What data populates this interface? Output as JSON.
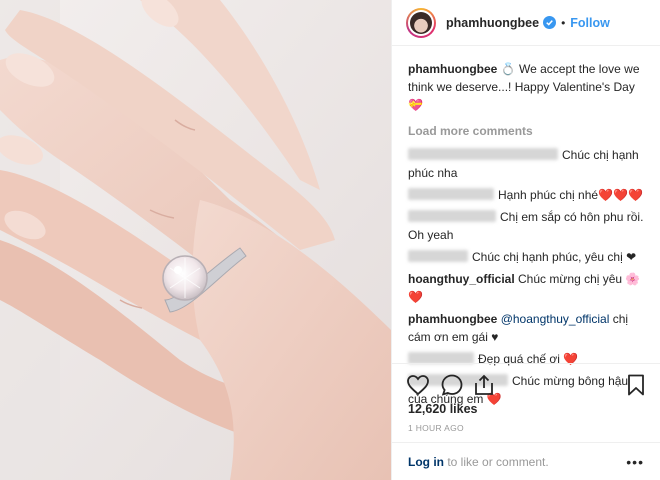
{
  "header": {
    "username": "phamhuongbee",
    "separator": "•",
    "follow_label": "Follow"
  },
  "caption": {
    "username": "phamhuongbee",
    "text": "We accept the love we think we deserve...! Happy Valentine's Day",
    "emoji_ring": "💍",
    "emoji_heart": "💝"
  },
  "load_more_label": "Load more comments",
  "comments": [
    {
      "user_hidden": true,
      "text": "Chúc chị hạnh phúc nha"
    },
    {
      "user_hidden": true,
      "text": "Hạnh phúc chị nhé❤️❤️❤️"
    },
    {
      "user_hidden": true,
      "text": "Chị em sắp có hôn phu rồi. Oh yeah"
    },
    {
      "user_hidden": true,
      "text": "Chúc chị hạnh phúc, yêu chị ❤"
    },
    {
      "user": "hoangthuy_official",
      "text": "Chúc mừng chị yêu 🌸❤️"
    },
    {
      "user": "phamhuongbee",
      "mention": "@hoangthuy_official",
      "text": "chị cám ơn em gái ♥"
    },
    {
      "user_hidden": true,
      "text": "Đẹp quá chế ơi ❤️"
    },
    {
      "user_hidden": true,
      "text": "Chúc mừng bông hậu của chúng em ❤️"
    }
  ],
  "actions": {
    "like_icon": "heart-outline-icon",
    "comment_icon": "speech-bubble-icon",
    "share_icon": "share-icon",
    "save_icon": "bookmark-icon"
  },
  "likes": "12,620 likes",
  "timestamp": "1 HOUR AGO",
  "footer": {
    "login_link": "Log in",
    "login_rest": " to like or comment.",
    "more": "•••"
  },
  "colors": {
    "accent": "#3897f0",
    "link": "#003569",
    "muted": "#999999",
    "heart": "#ed4956"
  }
}
